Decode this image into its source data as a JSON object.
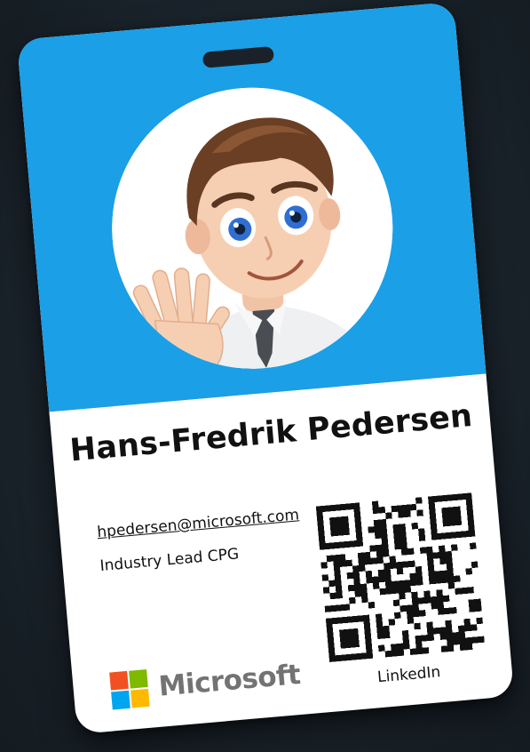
{
  "card": {
    "name": "Hans-Fredrik Pedersen",
    "email": "hpedersen@microsoft.com",
    "title": "Industry Lead CPG",
    "qr_label": "LinkedIn",
    "company": "Microsoft"
  },
  "colors": {
    "header_blue": "#1b9fe6",
    "ms_red": "#f25022",
    "ms_green": "#7fba00",
    "ms_blue": "#00a4ef",
    "ms_yellow": "#ffb900",
    "ms_gray": "#737373"
  },
  "icons": {
    "avatar": "waving-cartoon-man",
    "qr": "qr-code",
    "logo": "microsoft-logo"
  }
}
